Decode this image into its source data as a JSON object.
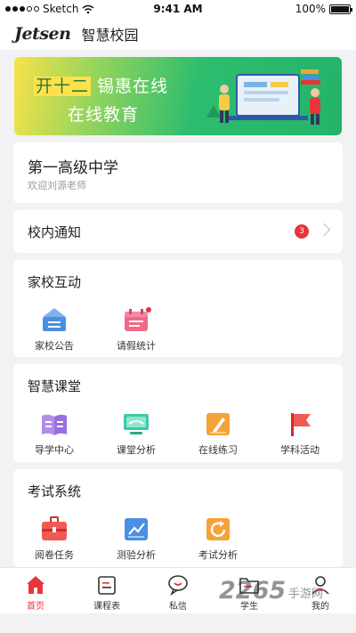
{
  "status_bar": {
    "carrier": "Sketch",
    "time": "9:41 AM",
    "battery": "100%"
  },
  "header": {
    "brand": "Jetsen",
    "title": "智慧校园"
  },
  "banner": {
    "highlight": "开十二",
    "line1_rest": " 锡惠在线",
    "line2": "在线教育"
  },
  "school": {
    "name": "第一高级中学",
    "welcome": "欢迎刘源老师"
  },
  "notice": {
    "title": "校内通知",
    "badge": "3"
  },
  "home_school": {
    "title": "家校互动",
    "items": [
      {
        "label": "家校公告",
        "icon": "announcement-icon"
      },
      {
        "label": "请假统计",
        "icon": "calendar-icon"
      }
    ]
  },
  "smart_class": {
    "title": "智慧课堂",
    "items": [
      {
        "label": "导学中心",
        "icon": "book-icon"
      },
      {
        "label": "课堂分析",
        "icon": "monitor-icon"
      },
      {
        "label": "在线练习",
        "icon": "pen-icon"
      },
      {
        "label": "学科活动",
        "icon": "flag-icon"
      }
    ]
  },
  "exam": {
    "title": "考试系统",
    "items": [
      {
        "label": "阅卷任务",
        "icon": "briefcase-icon"
      },
      {
        "label": "测验分析",
        "icon": "chart-icon"
      },
      {
        "label": "考试分析",
        "icon": "refresh-icon"
      }
    ]
  },
  "tabs": [
    {
      "label": "首页",
      "icon": "home-icon",
      "active": true
    },
    {
      "label": "课程表",
      "icon": "schedule-icon"
    },
    {
      "label": "私信",
      "icon": "message-icon"
    },
    {
      "label": "学生",
      "icon": "folder-icon"
    },
    {
      "label": "我的",
      "icon": "user-icon"
    }
  ],
  "watermark": {
    "number": "2265",
    "text": "手游网"
  },
  "colors": {
    "accent": "#e8343a",
    "banner_green": "#23b46a",
    "blue": "#4a90e2",
    "pink": "#f06a8a",
    "purple": "#9b6fe0",
    "teal": "#3cc9a8",
    "orange": "#f5a23a"
  }
}
